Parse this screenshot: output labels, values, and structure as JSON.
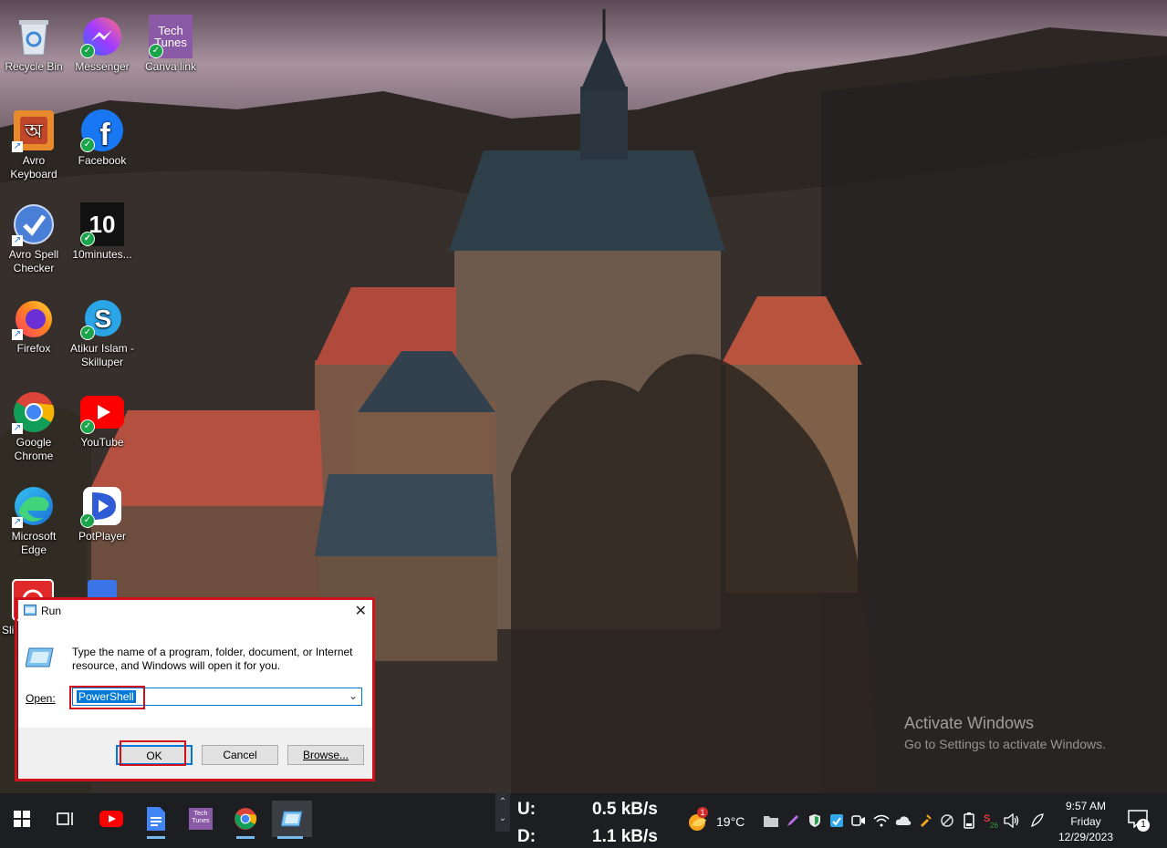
{
  "desktop": {
    "icons": [
      {
        "label": "Recycle Bin"
      },
      {
        "label": "Messenger"
      },
      {
        "label": "Canva link"
      },
      {
        "label": "Avro Keyboard"
      },
      {
        "label": "Facebook"
      },
      {
        "label": "Avro Spell Checker"
      },
      {
        "label": "10minutes..."
      },
      {
        "label": "Firefox"
      },
      {
        "label": "Atikur Islam - Skilluper"
      },
      {
        "label": "Google Chrome"
      },
      {
        "label": "YouTube"
      },
      {
        "label": "Microsoft Edge"
      },
      {
        "label": "PotPlayer"
      },
      {
        "label": "Sli"
      }
    ],
    "canva_thumb_text": "Tech Tunes",
    "tenminutes_text": "10"
  },
  "run_dialog": {
    "title": "Run",
    "description": "Type the name of a program, folder, document, or Internet resource, and Windows will open it for you.",
    "open_label": "Open:",
    "input_value": "PowerShell",
    "ok_label": "OK",
    "cancel_label": "Cancel",
    "browse_label": "Browse..."
  },
  "watermark": {
    "line1": "Activate Windows",
    "line2": "Go to Settings to activate Windows."
  },
  "taskbar": {
    "upload_label": "U:",
    "upload_value": "0.5 kB/s",
    "download_label": "D:",
    "download_value": "1.1 kB/s",
    "weather_badge": "1",
    "temperature": "19°C",
    "time": "9:57 AM",
    "day": "Friday",
    "date": "12/29/2023",
    "notification_count": "1"
  }
}
